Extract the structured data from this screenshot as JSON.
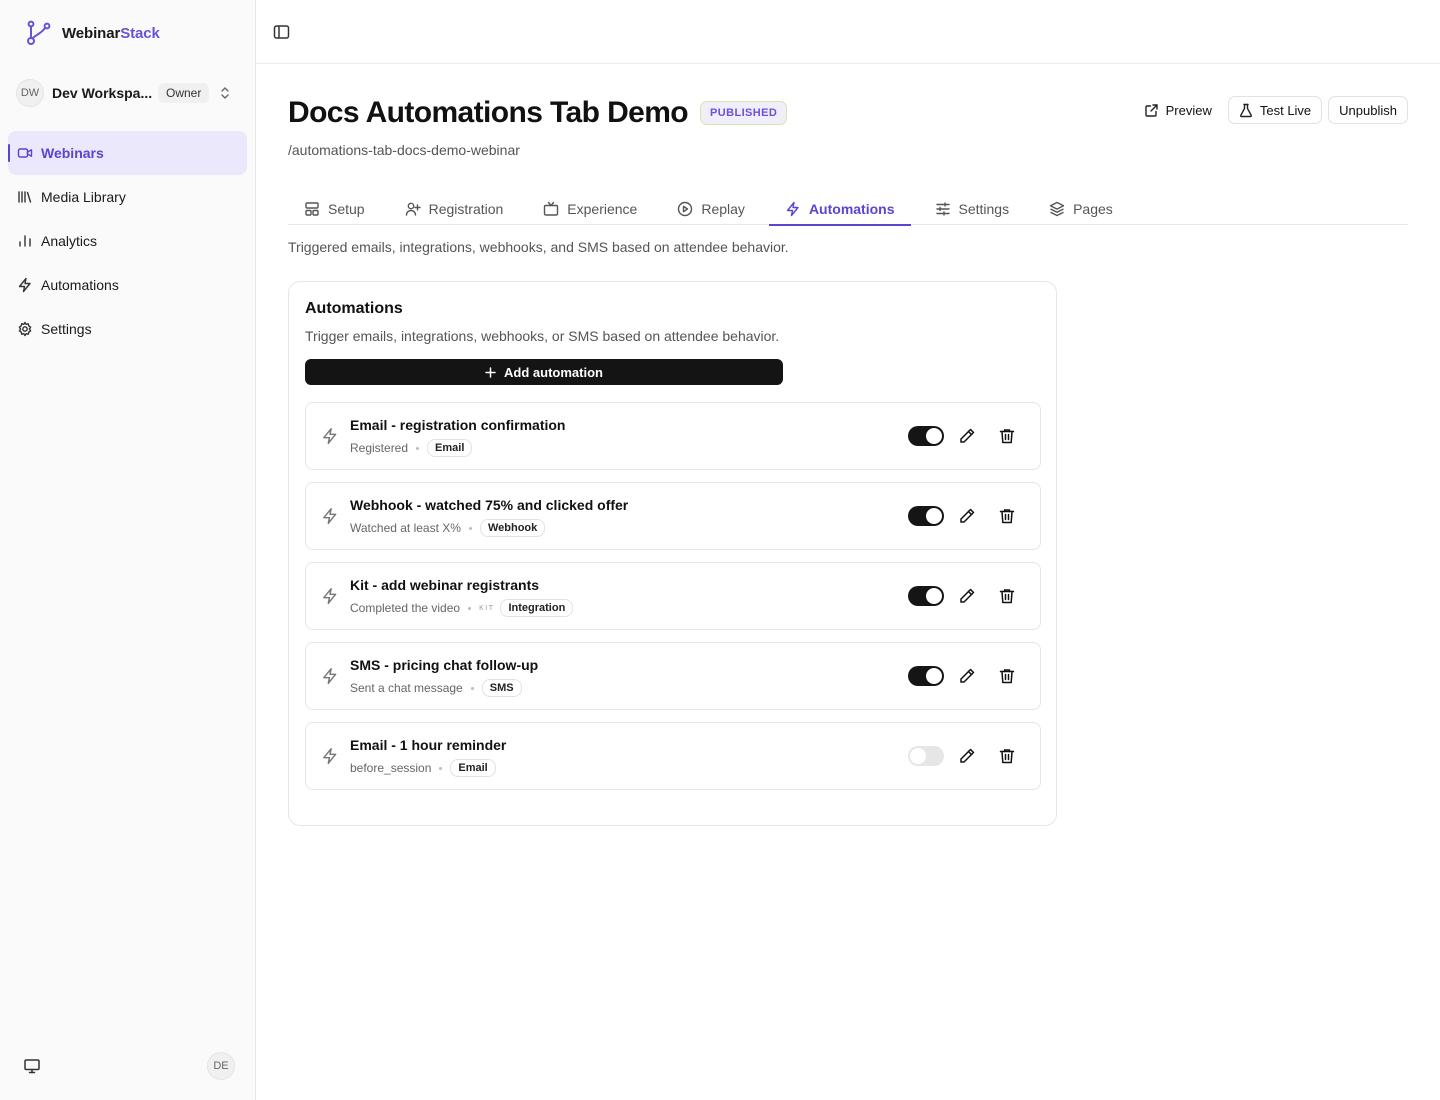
{
  "brand": {
    "name_prefix": "Webinar",
    "name_accent": "Stack",
    "accent_color": "#6b50d8"
  },
  "workspace": {
    "initials": "DW",
    "name": "Dev Workspa...",
    "role": "Owner"
  },
  "sidebar": {
    "items": [
      {
        "label": "Webinars",
        "icon": "video-icon",
        "active": true
      },
      {
        "label": "Media Library",
        "icon": "library-icon"
      },
      {
        "label": "Analytics",
        "icon": "bar-chart-icon"
      },
      {
        "label": "Automations",
        "icon": "zap-icon"
      },
      {
        "label": "Settings",
        "icon": "gear-icon"
      }
    ],
    "user_initials": "DE"
  },
  "header": {
    "title": "Docs Automations Tab Demo",
    "status": "PUBLISHED",
    "slug": "/automations-tab-docs-demo-webinar",
    "actions": {
      "preview": "Preview",
      "test_live": "Test Live",
      "unpublish": "Unpublish"
    }
  },
  "tabs": [
    {
      "label": "Setup",
      "icon": "layout-icon"
    },
    {
      "label": "Registration",
      "icon": "user-plus-icon"
    },
    {
      "label": "Experience",
      "icon": "tv-icon"
    },
    {
      "label": "Replay",
      "icon": "play-circle-icon"
    },
    {
      "label": "Automations",
      "icon": "zap-icon",
      "active": true
    },
    {
      "label": "Settings",
      "icon": "sliders-icon"
    },
    {
      "label": "Pages",
      "icon": "layers-icon"
    }
  ],
  "tab_description": "Triggered emails, integrations, webhooks, and SMS based on attendee behavior.",
  "automations": {
    "title": "Automations",
    "subtitle": "Trigger emails, integrations, webhooks, or SMS based on attendee behavior.",
    "add_label": "Add automation",
    "rules": [
      {
        "name": "Email - registration confirmation",
        "trigger": "Registered",
        "type": "Email",
        "enabled": true
      },
      {
        "name": "Webhook - watched 75% and clicked offer",
        "trigger": "Watched at least X%",
        "type": "Webhook",
        "enabled": true
      },
      {
        "name": "Kit - add webinar registrants",
        "trigger": "Completed the video",
        "logo": "KIT",
        "type": "Integration",
        "enabled": true
      },
      {
        "name": "SMS - pricing chat follow-up",
        "trigger": "Sent a chat message",
        "type": "SMS",
        "enabled": true
      },
      {
        "name": "Email - 1 hour reminder",
        "trigger": "before_session",
        "type": "Email",
        "enabled": false
      }
    ]
  }
}
